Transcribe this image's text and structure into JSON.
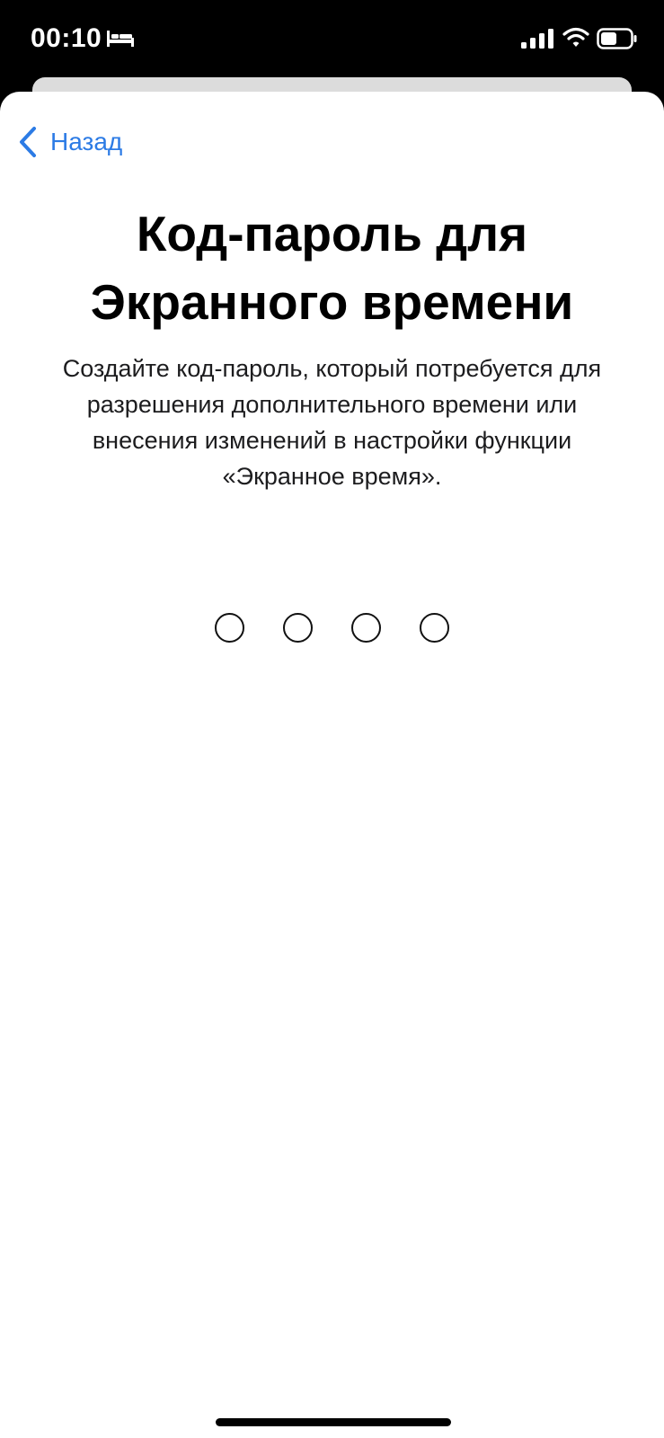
{
  "status_bar": {
    "time": "00:10",
    "icons": [
      "bed-icon",
      "signal-icon",
      "wifi-icon",
      "battery-icon"
    ]
  },
  "navigation": {
    "back_label": "Назад",
    "back_icon": "chevron-left-icon"
  },
  "content": {
    "title": "Код-пароль для Экранного времени",
    "description": "Создайте код-пароль, который потребуется для разрешения дополнительного времени или внесения изменений в настройки функции «Экранное время»."
  },
  "passcode": {
    "length": 4,
    "entered": 0
  },
  "colors": {
    "accent": "#2c7be5",
    "background": "#ffffff",
    "status_bar": "#000000"
  }
}
